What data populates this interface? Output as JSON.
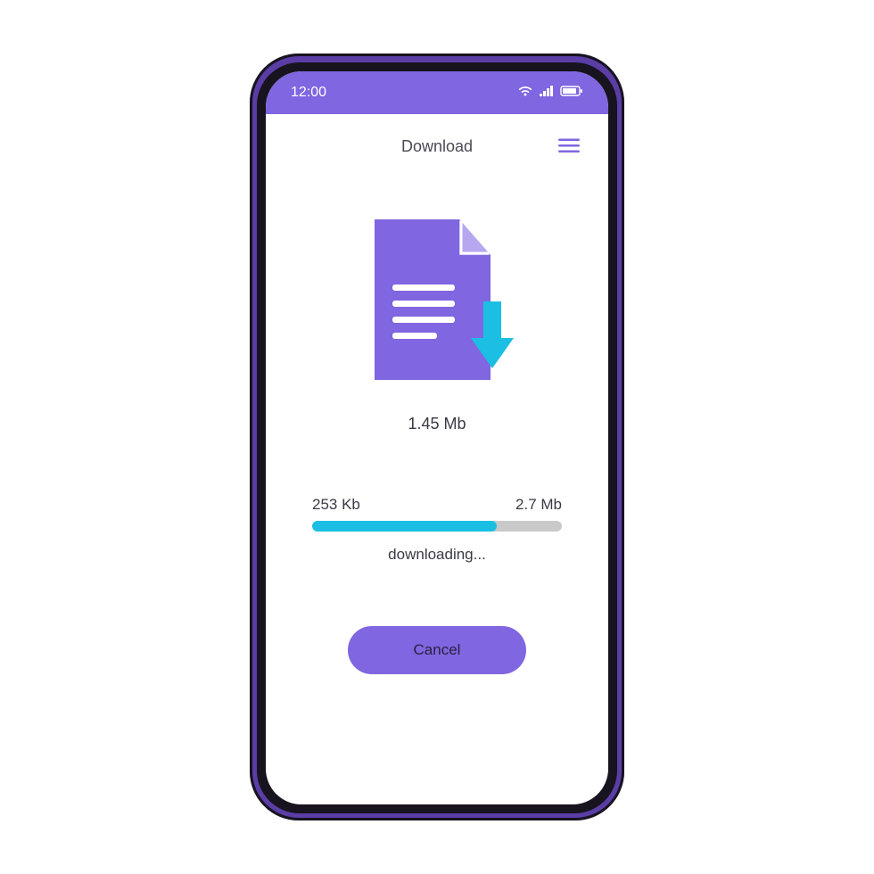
{
  "statusBar": {
    "time": "12:00"
  },
  "header": {
    "title": "Download"
  },
  "file": {
    "size": "1.45 Mb"
  },
  "progress": {
    "downloaded": "253 Kb",
    "total": "2.7 Mb",
    "percent": 74,
    "statusText": "downloading..."
  },
  "actions": {
    "cancelLabel": "Cancel"
  },
  "colors": {
    "accent": "#8066e0",
    "progressFill": "#1bbfe3"
  }
}
